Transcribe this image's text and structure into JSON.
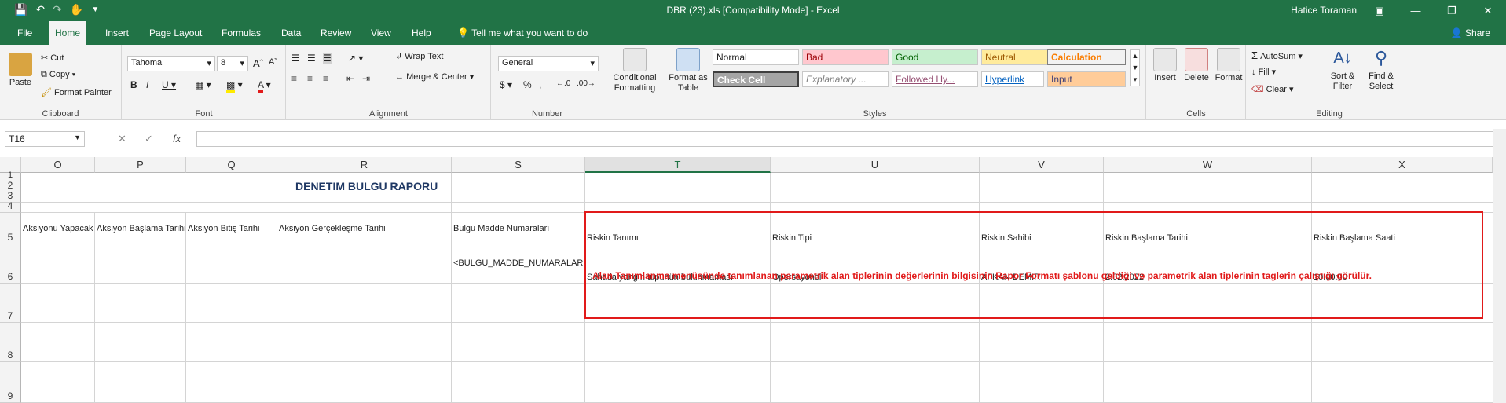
{
  "window": {
    "title": "DBR (23).xls  [Compatibility Mode]  -  Excel",
    "user": "Hatice Toraman"
  },
  "tabs": [
    "File",
    "Home",
    "Insert",
    "Page Layout",
    "Formulas",
    "Data",
    "Review",
    "View",
    "Help"
  ],
  "tell_me": "Tell me what you want to do",
  "share": "Share",
  "ribbon": {
    "clipboard": {
      "paste": "Paste",
      "cut": "Cut",
      "copy": "Copy",
      "format_painter": "Format Painter",
      "label": "Clipboard"
    },
    "font": {
      "name": "Tahoma",
      "size": "8",
      "label": "Font"
    },
    "alignment": {
      "wrap_text": "Wrap Text",
      "merge_center": "Merge & Center",
      "label": "Alignment"
    },
    "number": {
      "format": "General",
      "label": "Number"
    },
    "styles": {
      "conditional_formatting": "Conditional Formatting",
      "format_as_table": "Format as Table",
      "cells": [
        "Normal",
        "Bad",
        "Good",
        "Neutral",
        "Calculation",
        "Check Cell",
        "Explanatory ...",
        "Followed Hy...",
        "Hyperlink",
        "Input"
      ],
      "label": "Styles"
    },
    "cells": {
      "insert": "Insert",
      "delete": "Delete",
      "format": "Format",
      "label": "Cells"
    },
    "editing": {
      "autosum": "AutoSum",
      "fill": "Fill",
      "clear": "Clear",
      "sort_filter": "Sort & Filter",
      "find_select": "Find & Select",
      "label": "Editing"
    }
  },
  "formula_bar": {
    "name_box": "T16",
    "fx": "fx",
    "value": ""
  },
  "columns": [
    "O",
    "P",
    "Q",
    "R",
    "S",
    "T",
    "U",
    "V",
    "W",
    "X"
  ],
  "rows": [
    "1",
    "2",
    "3",
    "4",
    "5",
    "6",
    "7",
    "8",
    "9"
  ],
  "sheet": {
    "report_title": "DENETIM BULGU RAPORU",
    "headers_left": [
      "Aksiyonu Yapacak",
      "Aksiyon Başlama Tarihi",
      "Aksiyon Bitiş     Tarihi",
      "Aksiyon Gerçekleşme Tarihi",
      "Bulgu Madde Numaraları"
    ],
    "bulgu_placeholder": "<BULGU_MADDE_NUMARALARI>",
    "headers_right": [
      "Riskin Tanımı",
      "Riskin Tipi",
      "Riskin Sahibi",
      "Riskin Başlama Tarihi",
      "Riskin Başlama Saati"
    ],
    "values_right": [
      "Sahada yangın tüpünün bulunmaması",
      "Opersayonel",
      "AFKAN DEMİR",
      "2.02.2022",
      "10:00:00"
    ],
    "note": "Alan Tanımlanma menüsünde tanımlanan  parametrik alan tiplerinin değerlerinin bilgisinin  Rapor Formatı şablonu geldiği ve parametrik alan tiplerinin taglerin çalıştığı görülür."
  }
}
